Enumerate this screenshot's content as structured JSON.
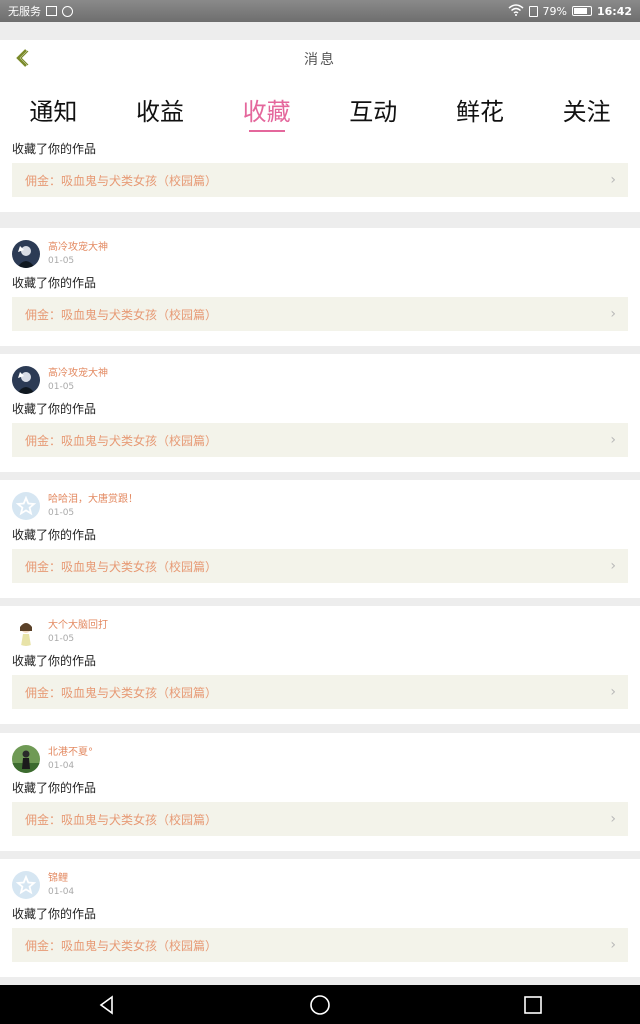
{
  "status_bar": {
    "carrier": "无服务",
    "battery_percent": "79%",
    "battery_level": 0.79,
    "time": "16:42"
  },
  "header": {
    "title": "消息"
  },
  "tabs": [
    {
      "label": "通知",
      "active": false
    },
    {
      "label": "收益",
      "active": false
    },
    {
      "label": "收藏",
      "active": true
    },
    {
      "label": "互动",
      "active": false
    },
    {
      "label": "鲜花",
      "active": false
    },
    {
      "label": "关注",
      "active": false
    }
  ],
  "items": [
    {
      "user": "",
      "date": "",
      "action": "收藏了你的作品",
      "work": "佣金：吸血鬼与犬类女孩（校园篇）"
    },
    {
      "user": "高冷攻宠大神",
      "date": "01-05",
      "action": "收藏了你的作品",
      "work": "佣金：吸血鬼与犬类女孩（校园篇）",
      "avatar": "dark"
    },
    {
      "user": "高冷攻宠大神",
      "date": "01-05",
      "action": "收藏了你的作品",
      "work": "佣金：吸血鬼与犬类女孩（校园篇）",
      "avatar": "dark"
    },
    {
      "user": "哈哈泪，大唐赏跟！",
      "date": "01-05",
      "action": "收藏了你的作品",
      "work": "佣金：吸血鬼与犬类女孩（校园篇）",
      "avatar": "star"
    },
    {
      "user": "大个大脑回打",
      "date": "01-05",
      "action": "收藏了你的作品",
      "work": "佣金：吸血鬼与犬类女孩（校园篇）",
      "avatar": "girl"
    },
    {
      "user": "北港不夏°",
      "date": "01-04",
      "action": "收藏了你的作品",
      "work": "佣金：吸血鬼与犬类女孩（校园篇）",
      "avatar": "green"
    },
    {
      "user": "锦鲤",
      "date": "01-04",
      "action": "收藏了你的作品",
      "work": "佣金：吸血鬼与犬类女孩（校园篇）",
      "avatar": "star"
    }
  ],
  "colors": {
    "accent": "#e4679c",
    "username": "#e38a62",
    "work_text": "#e79a75",
    "work_bg": "#f3f3ea"
  }
}
